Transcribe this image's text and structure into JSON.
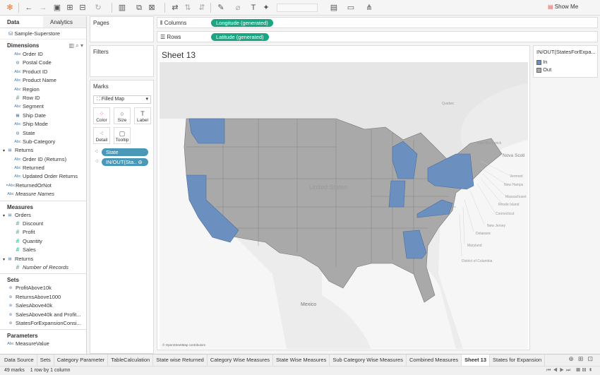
{
  "toolbar": {
    "show_me": "Show Me",
    "icons": [
      "tableau-logo",
      "back",
      "forward",
      "save",
      "new-datasource",
      "pause",
      "refresh",
      "new-worksheet",
      "duplicate",
      "clear",
      "swap",
      "sort-asc",
      "sort-desc",
      "highlight",
      "group",
      "label",
      "pin",
      "fit",
      "presentation",
      "share"
    ]
  },
  "left": {
    "tabs": [
      "Data",
      "Analytics"
    ],
    "datasource": "Sample-Superstore",
    "dimensions_title": "Dimensions",
    "dimensions": [
      {
        "icon": "Abc",
        "label": "Order ID",
        "lvl": 2
      },
      {
        "icon": "globe",
        "label": "Postal Code",
        "lvl": 2
      },
      {
        "icon": "Abc",
        "label": "Product ID",
        "lvl": 2
      },
      {
        "icon": "Abc",
        "label": "Product Name",
        "lvl": 2
      },
      {
        "icon": "Abc",
        "label": "Region",
        "lvl": 2
      },
      {
        "icon": "#",
        "label": "Row ID",
        "lvl": 2
      },
      {
        "icon": "Abc",
        "label": "Segment",
        "lvl": 2
      },
      {
        "icon": "calendar",
        "label": "Ship Date",
        "lvl": 2
      },
      {
        "icon": "Abc",
        "label": "Ship Mode",
        "lvl": 2
      },
      {
        "icon": "globe",
        "label": "State",
        "lvl": 2
      },
      {
        "icon": "Abc",
        "label": "Sub-Category",
        "lvl": 2
      },
      {
        "icon": "table",
        "label": "Returns",
        "lvl": 1
      },
      {
        "icon": "Abc",
        "label": "Order ID (Returns)",
        "lvl": 2
      },
      {
        "icon": "Abc",
        "label": "Returned",
        "lvl": 2
      },
      {
        "icon": "Abc",
        "label": "Updated Order Returns",
        "lvl": 2
      },
      {
        "icon": "calc",
        "label": "ReturnedOrNot",
        "lvl": 0
      },
      {
        "icon": "Abc",
        "label": "Measure Names",
        "lvl": 0,
        "italic": true
      }
    ],
    "measures_title": "Measures",
    "measures": [
      {
        "icon": "table",
        "label": "Orders",
        "lvl": 1
      },
      {
        "icon": "#",
        "label": "Discount",
        "lvl": 2
      },
      {
        "icon": "#",
        "label": "Profit",
        "lvl": 2
      },
      {
        "icon": "#",
        "label": "Quantity",
        "lvl": 2
      },
      {
        "icon": "#",
        "label": "Sales",
        "lvl": 2
      },
      {
        "icon": "table",
        "label": "Returns",
        "lvl": 1
      },
      {
        "icon": "#",
        "label": "Number of Records",
        "lvl": 2,
        "italic": true
      }
    ],
    "sets_title": "Sets",
    "sets": [
      "ProfitAbove10k",
      "ReturnsAbove1000",
      "SalesAbove40k",
      "SalesAbove40k and Profit...",
      "StatesForExpansionConsi..."
    ],
    "parameters_title": "Parameters",
    "parameters": [
      "MeasureValue"
    ]
  },
  "cards": {
    "pages": "Pages",
    "filters": "Filters",
    "marks": "Marks",
    "mark_type": "Filled Map",
    "buttons": [
      "Color",
      "Size",
      "Label",
      "Detail",
      "Tooltip"
    ],
    "pills": [
      "State",
      "IN/OUT(Sta.."
    ]
  },
  "shelves": {
    "columns_label": "Columns",
    "columns_pill": "Longitude (generated)",
    "rows_label": "Rows",
    "rows_pill": "Latitude (generated)"
  },
  "sheet": {
    "title": "Sheet 13",
    "map_labels": {
      "country": "United States",
      "mexico": "Mexico",
      "quebec": "Quebec",
      "new_brunswick": "New Brunswick",
      "nova_scotia": "Nova Scoti",
      "attribution": "© OpenStreetMap contributors"
    },
    "callouts": [
      "Vermont",
      "New Hamps",
      "Massachuset",
      "Rhode Island",
      "Connecticut",
      "New Jersey",
      "Delaware",
      "Maryland",
      "District of Columbia"
    ]
  },
  "legend": {
    "title": "IN/OUT(StatesForExpa...",
    "items": [
      {
        "label": "In",
        "color": "#6b8fbf"
      },
      {
        "label": "Out",
        "color": "#a9a9a9"
      }
    ]
  },
  "colors": {
    "in": "#6b8fbf",
    "out": "#a9a9a9",
    "pill_green": "#1aa683",
    "pill_blue": "#4a98b8"
  },
  "tabs": [
    "Data Source",
    "Sets",
    "Category Parameter",
    "TableCalculation",
    "State wise Returned",
    "Category Wise Measures",
    "State Wise Measures",
    "Sub Category Wise Measures",
    "Combined Measures",
    "Sheet 13",
    "States for Expansion"
  ],
  "active_tab": "Sheet 13",
  "status": {
    "marks": "49 marks",
    "dims": "1 row by 1 column"
  }
}
